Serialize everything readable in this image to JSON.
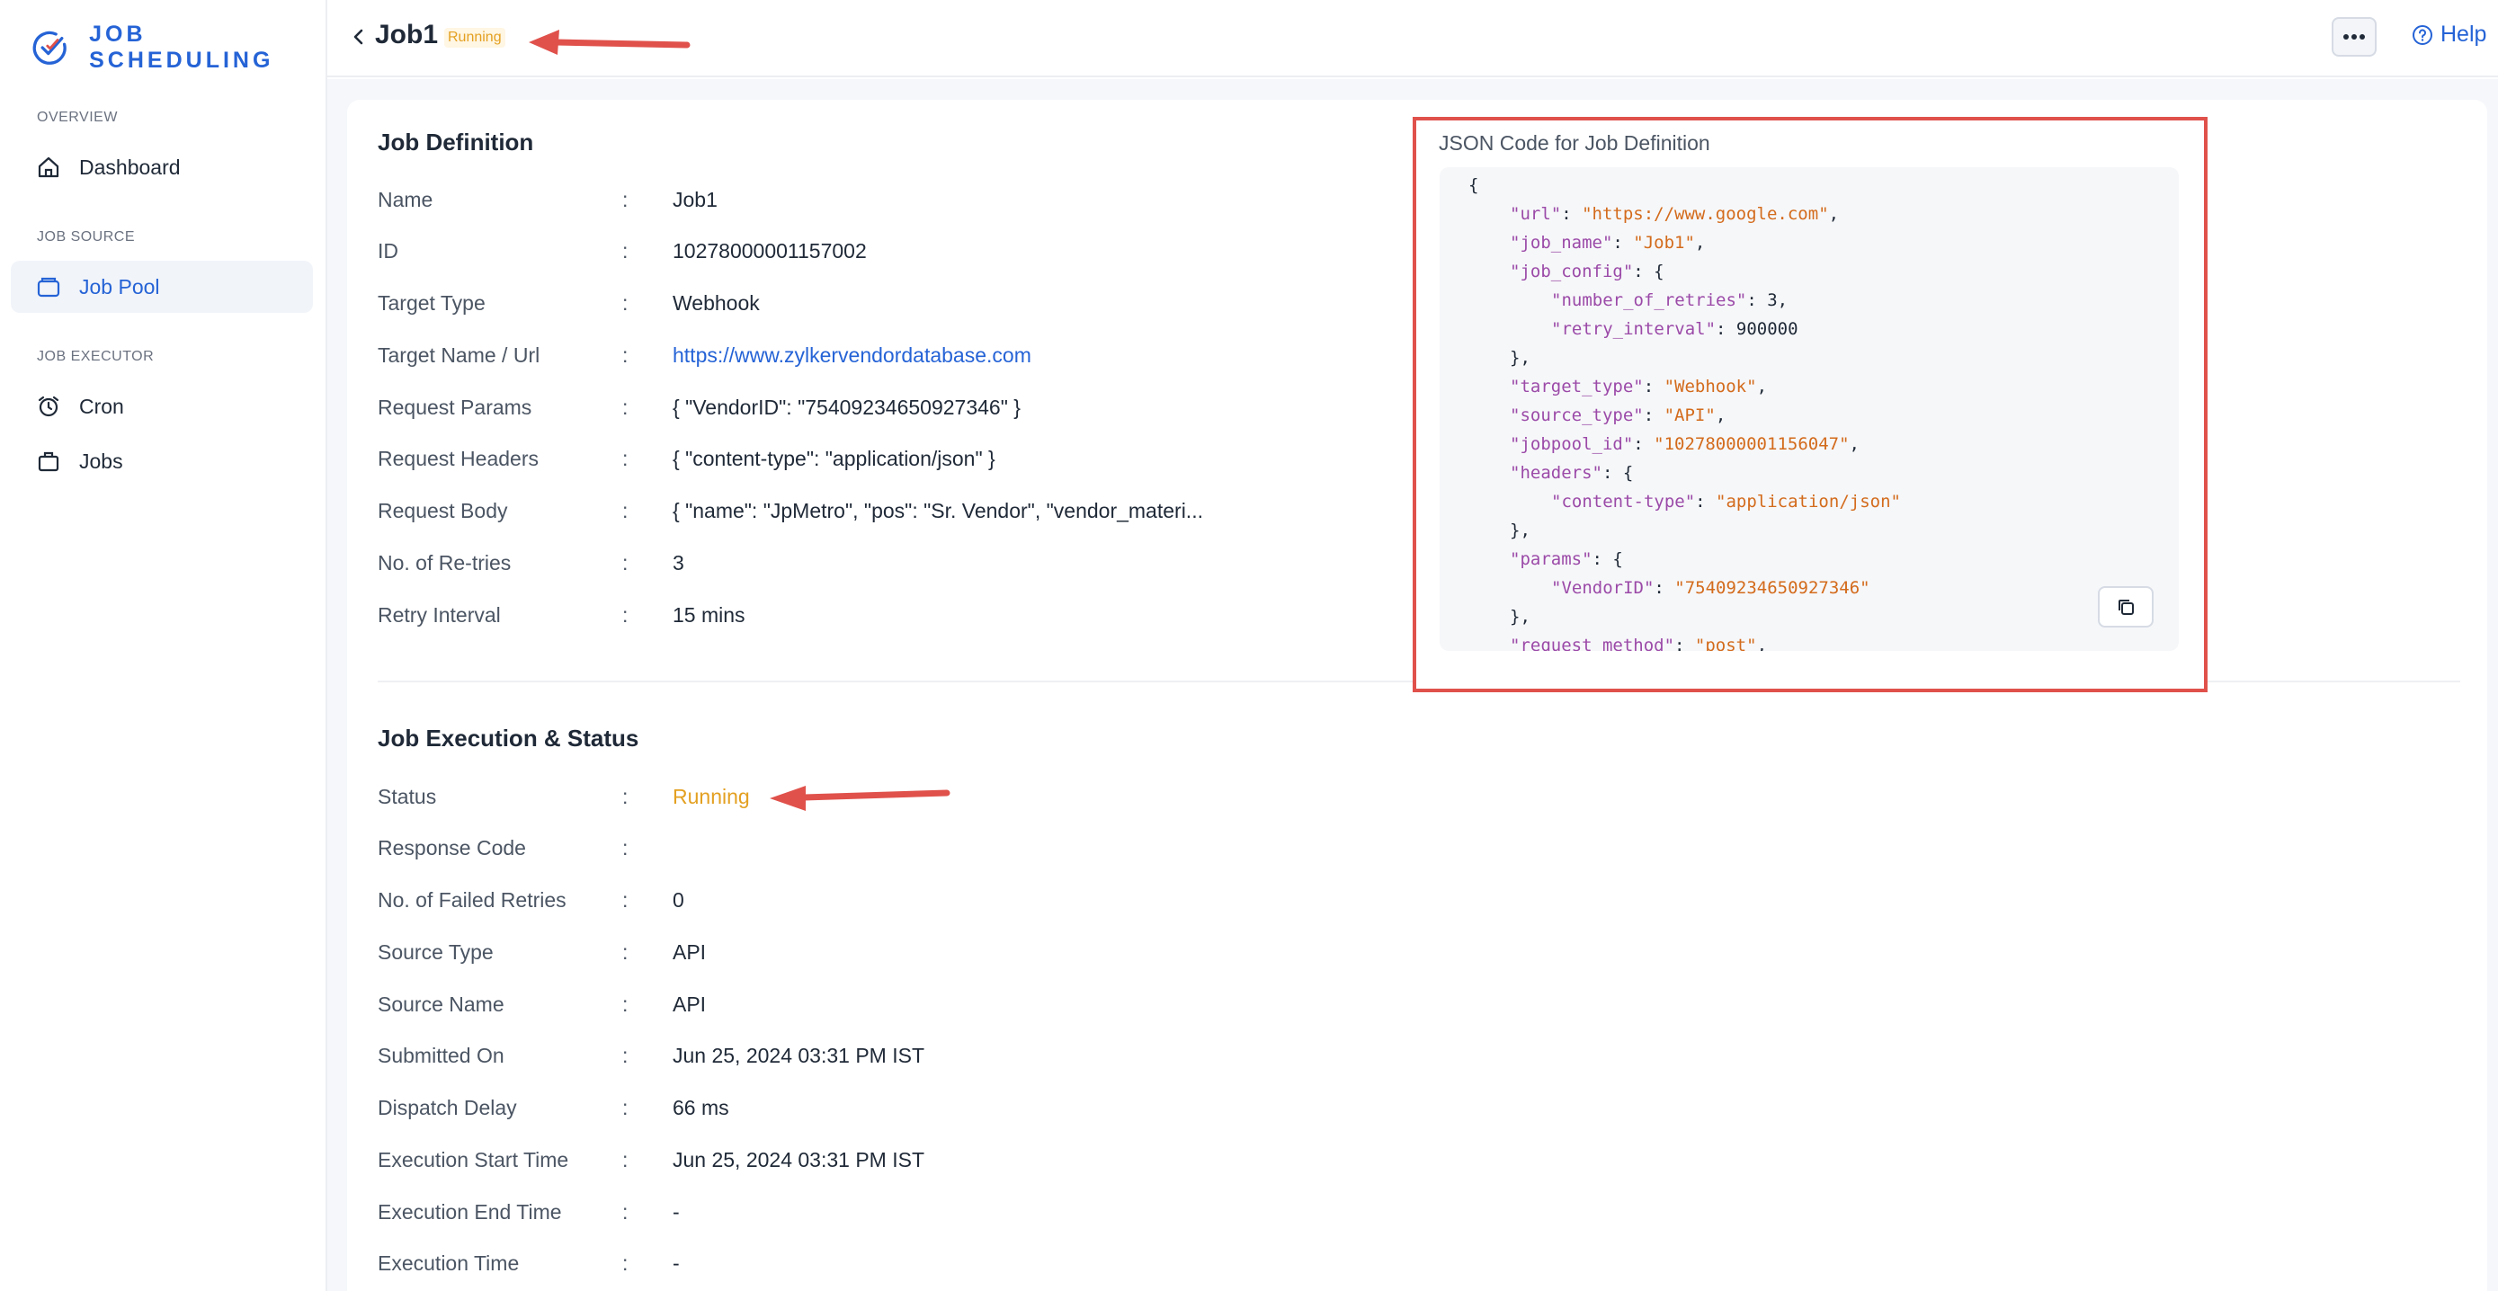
{
  "app": {
    "brand": "JOB SCHEDULING"
  },
  "sidebar": {
    "sections": [
      {
        "title": "OVERVIEW",
        "items": [
          {
            "label": "Dashboard",
            "icon": "home-icon"
          }
        ]
      },
      {
        "title": "JOB SOURCE",
        "items": [
          {
            "label": "Job Pool",
            "icon": "briefcase-icon",
            "active": true
          }
        ]
      },
      {
        "title": "JOB EXECUTOR",
        "items": [
          {
            "label": "Cron",
            "icon": "alarm-clock-icon"
          },
          {
            "label": "Jobs",
            "icon": "bag-icon"
          }
        ]
      }
    ]
  },
  "header": {
    "job_name": "Job1",
    "status_badge": "Running",
    "help_label": "Help"
  },
  "job_definition": {
    "title": "Job Definition",
    "rows": [
      {
        "label": "Name",
        "value": "Job1"
      },
      {
        "label": "ID",
        "value": "10278000001157002"
      },
      {
        "label": "Target Type",
        "value": "Webhook"
      },
      {
        "label": "Target Name / Url",
        "value": "https://www.zylkervendordatabase.com"
      },
      {
        "label": "Request Params",
        "value": "{ \"VendorID\": \"75409234650927346\" }"
      },
      {
        "label": "Request Headers",
        "value": "{ \"content-type\": \"application/json\" }"
      },
      {
        "label": "Request Body",
        "value": "{ \"name\": \"JpMetro\", \"pos\": \"Sr. Vendor\", \"vendor_materi..."
      },
      {
        "label": "No. of Re-tries",
        "value": "3"
      },
      {
        "label": "Retry Interval",
        "value": "15 mins"
      }
    ]
  },
  "json_panel": {
    "title": "JSON Code for Job Definition",
    "lines": [
      {
        "indent": 0,
        "parts": [
          {
            "t": "{",
            "c": "n"
          }
        ]
      },
      {
        "indent": 1,
        "parts": [
          {
            "t": "\"url\"",
            "c": "k"
          },
          {
            "t": ": ",
            "c": "n"
          },
          {
            "t": "\"https://www.google.com\"",
            "c": "s"
          },
          {
            "t": ",",
            "c": "n"
          }
        ]
      },
      {
        "indent": 1,
        "parts": [
          {
            "t": "\"job_name\"",
            "c": "k"
          },
          {
            "t": ": ",
            "c": "n"
          },
          {
            "t": "\"Job1\"",
            "c": "s"
          },
          {
            "t": ",",
            "c": "n"
          }
        ]
      },
      {
        "indent": 1,
        "parts": [
          {
            "t": "\"job_config\"",
            "c": "k"
          },
          {
            "t": ": {",
            "c": "n"
          }
        ]
      },
      {
        "indent": 2,
        "parts": [
          {
            "t": "\"number_of_retries\"",
            "c": "k"
          },
          {
            "t": ": 3,",
            "c": "n"
          }
        ]
      },
      {
        "indent": 2,
        "parts": [
          {
            "t": "\"retry_interval\"",
            "c": "k"
          },
          {
            "t": ": 900000",
            "c": "n"
          }
        ]
      },
      {
        "indent": 1,
        "parts": [
          {
            "t": "},",
            "c": "n"
          }
        ]
      },
      {
        "indent": 1,
        "parts": [
          {
            "t": "\"target_type\"",
            "c": "k"
          },
          {
            "t": ": ",
            "c": "n"
          },
          {
            "t": "\"Webhook\"",
            "c": "s"
          },
          {
            "t": ",",
            "c": "n"
          }
        ]
      },
      {
        "indent": 1,
        "parts": [
          {
            "t": "\"source_type\"",
            "c": "k"
          },
          {
            "t": ": ",
            "c": "n"
          },
          {
            "t": "\"API\"",
            "c": "s"
          },
          {
            "t": ",",
            "c": "n"
          }
        ]
      },
      {
        "indent": 1,
        "parts": [
          {
            "t": "\"jobpool_id\"",
            "c": "k"
          },
          {
            "t": ": ",
            "c": "n"
          },
          {
            "t": "\"10278000001156047\"",
            "c": "s"
          },
          {
            "t": ",",
            "c": "n"
          }
        ]
      },
      {
        "indent": 1,
        "parts": [
          {
            "t": "\"headers\"",
            "c": "k"
          },
          {
            "t": ": {",
            "c": "n"
          }
        ]
      },
      {
        "indent": 2,
        "parts": [
          {
            "t": "\"content-type\"",
            "c": "k"
          },
          {
            "t": ": ",
            "c": "n"
          },
          {
            "t": "\"application/json\"",
            "c": "s"
          }
        ]
      },
      {
        "indent": 1,
        "parts": [
          {
            "t": "},",
            "c": "n"
          }
        ]
      },
      {
        "indent": 1,
        "parts": [
          {
            "t": "\"params\"",
            "c": "k"
          },
          {
            "t": ": {",
            "c": "n"
          }
        ]
      },
      {
        "indent": 2,
        "parts": [
          {
            "t": "\"VendorID\"",
            "c": "k"
          },
          {
            "t": ": ",
            "c": "n"
          },
          {
            "t": "\"75409234650927346\"",
            "c": "s"
          }
        ]
      },
      {
        "indent": 1,
        "parts": [
          {
            "t": "},",
            "c": "n"
          }
        ]
      },
      {
        "indent": 1,
        "parts": [
          {
            "t": "\"request_method\"",
            "c": "k"
          },
          {
            "t": ": ",
            "c": "n"
          },
          {
            "t": "\"post\"",
            "c": "s"
          },
          {
            "t": ",",
            "c": "n"
          }
        ]
      }
    ]
  },
  "job_execution": {
    "title": "Job Execution & Status",
    "rows": [
      {
        "label": "Status",
        "value": "Running"
      },
      {
        "label": "Response Code",
        "value": ""
      },
      {
        "label": "No. of Failed Retries",
        "value": "0"
      },
      {
        "label": "Source Type",
        "value": "API"
      },
      {
        "label": "Source Name",
        "value": "API"
      },
      {
        "label": "Submitted On",
        "value": "Jun 25, 2024 03:31 PM IST"
      },
      {
        "label": "Dispatch Delay",
        "value": "66 ms"
      },
      {
        "label": "Execution Start Time",
        "value": "Jun 25, 2024 03:31 PM IST"
      },
      {
        "label": "Execution End Time",
        "value": "-"
      },
      {
        "label": "Execution Time",
        "value": "-"
      }
    ]
  },
  "colors": {
    "accent": "#2563d6",
    "running": "#e3a021",
    "annotation": "#e0514b"
  }
}
